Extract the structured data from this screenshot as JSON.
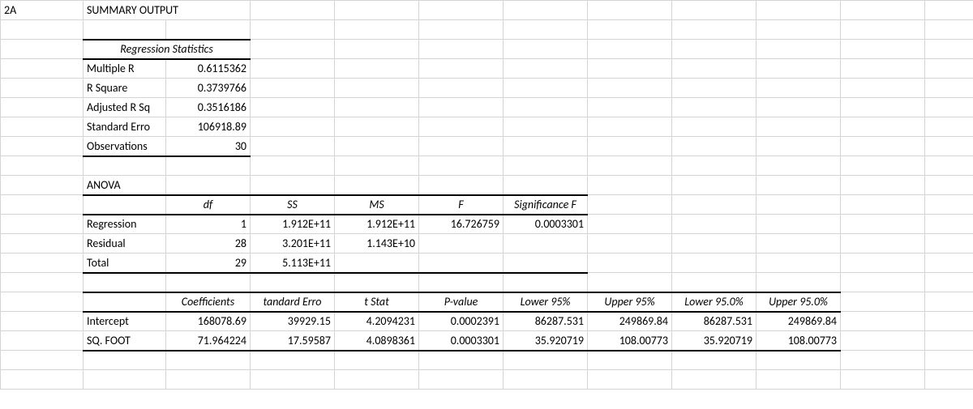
{
  "meta": {
    "question_label": "2A",
    "title": "SUMMARY OUTPUT"
  },
  "regstats": {
    "heading": "Regression Statistics",
    "rows": {
      "multiple_r": {
        "label": "Multiple R",
        "value": "0.6115362"
      },
      "r_square": {
        "label": "R Square",
        "value": "0.3739766"
      },
      "adj_r_square": {
        "label": "Adjusted R Sq",
        "value": "0.3516186"
      },
      "std_error": {
        "label": "Standard Erro",
        "value": "106918.89"
      },
      "observations": {
        "label": "Observations",
        "value": "30"
      }
    }
  },
  "anova": {
    "heading": "ANOVA",
    "headers": {
      "df": "df",
      "ss": "SS",
      "ms": "MS",
      "f": "F",
      "sigf": "Significance F"
    },
    "rows": {
      "regression": {
        "label": "Regression",
        "df": "1",
        "ss": "1.912E+11",
        "ms": "1.912E+11",
        "f": "16.726759",
        "sigf": "0.0003301"
      },
      "residual": {
        "label": "Residual",
        "df": "28",
        "ss": "3.201E+11",
        "ms": "1.143E+10",
        "f": "",
        "sigf": ""
      },
      "total": {
        "label": "Total",
        "df": "29",
        "ss": "5.113E+11",
        "ms": "",
        "f": "",
        "sigf": ""
      }
    }
  },
  "coef": {
    "headers": {
      "coefficients": "Coefficients",
      "stderr": "tandard Erro",
      "tstat": "t Stat",
      "pvalue": "P-value",
      "lower95": "Lower 95%",
      "upper95": "Upper 95%",
      "lower95_0": "Lower 95.0%",
      "upper95_0": "Upper 95.0%"
    },
    "rows": {
      "intercept": {
        "label": "Intercept",
        "coefficients": "168078.69",
        "stderr": "39929.15",
        "tstat": "4.2094231",
        "pvalue": "0.0002391",
        "lower95": "86287.531",
        "upper95": "249869.84",
        "lower95_0": "86287.531",
        "upper95_0": "249869.84"
      },
      "sqfoot": {
        "label": "SQ. FOOT",
        "coefficients": "71.964224",
        "stderr": "17.59587",
        "tstat": "4.0898361",
        "pvalue": "0.0003301",
        "lower95": "35.920719",
        "upper95": "108.00773",
        "lower95_0": "35.920719",
        "upper95_0": "108.00773"
      }
    }
  }
}
